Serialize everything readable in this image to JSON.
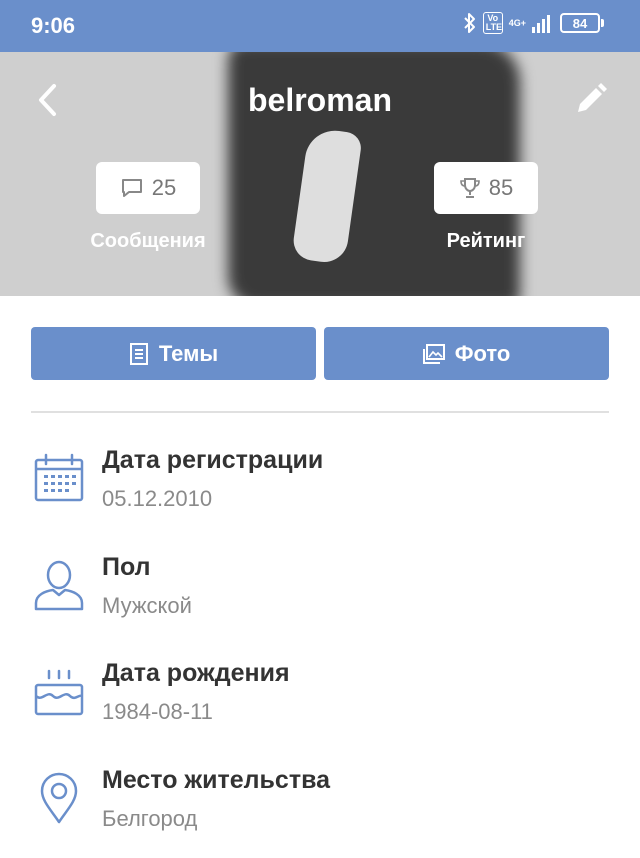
{
  "status_bar": {
    "time": "9:06",
    "volte_label": "Vo LTE",
    "network_label": "4G+",
    "battery": "84"
  },
  "profile": {
    "username": "belroman",
    "messages_count": "25",
    "messages_label": "Сообщения",
    "rating_count": "85",
    "rating_label": "Рейтинг"
  },
  "actions": {
    "topics_label": "Темы",
    "photo_label": "Фото"
  },
  "info": [
    {
      "title": "Дата регистрации",
      "value": "05.12.2010",
      "icon": "calendar-icon"
    },
    {
      "title": "Пол",
      "value": "Мужской",
      "icon": "person-icon"
    },
    {
      "title": "Дата рождения",
      "value": "1984-08-11",
      "icon": "birthday-cake-icon"
    },
    {
      "title": "Место жительства",
      "value": "Белгород",
      "icon": "location-pin-icon"
    }
  ],
  "colors": {
    "accent": "#6a8fcb",
    "icon_blue": "#6a8fcb",
    "text_dark": "#333333",
    "text_muted": "#8a8a8a"
  }
}
